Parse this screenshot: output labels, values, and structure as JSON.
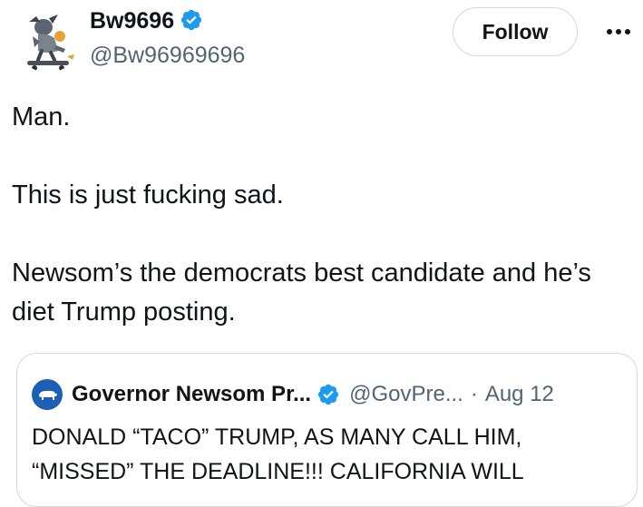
{
  "author": {
    "display_name": "Bw9696",
    "handle": "@Bw96969696",
    "verified": true
  },
  "actions": {
    "follow_label": "Follow",
    "more_icon": "more-horizontal-icon"
  },
  "tweet": {
    "paragraphs": [
      "Man.",
      "This is just fucking sad.",
      "Newsom’s the democrats best candidate and he’s diet Trump posting."
    ]
  },
  "quoted_tweet": {
    "display_name": "Governor Newsom Pr...",
    "handle": "@GovPre...",
    "separator": "·",
    "date": "Aug 12",
    "verified": true,
    "text": "DONALD “TACO” TRUMP,  AS MANY CALL HIM, “MISSED” THE DEADLINE!!! CALIFORNIA WILL"
  },
  "colors": {
    "verified_blue": "#1d9bf0",
    "text_primary": "#0f1419",
    "text_secondary": "#536471",
    "border": "#cfd9de"
  }
}
